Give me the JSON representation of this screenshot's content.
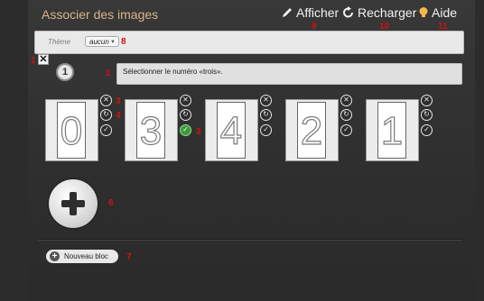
{
  "app": {
    "title": "Associer des images"
  },
  "toolbar": {
    "afficher": "Afficher",
    "recharger": "Recharger",
    "aide": "Aide"
  },
  "theme": {
    "label": "Thème",
    "value": "aucun"
  },
  "question": {
    "number": "1",
    "instruction": "Sélectionner le numéro «trois»."
  },
  "cards": [
    {
      "digit": "0",
      "checked": false
    },
    {
      "digit": "3",
      "checked": true
    },
    {
      "digit": "4",
      "checked": false
    },
    {
      "digit": "2",
      "checked": false
    },
    {
      "digit": "1",
      "checked": false
    }
  ],
  "new_block": "Nouveau bloc",
  "annotations": [
    "1",
    "2",
    "3",
    "3",
    "4",
    "6",
    "7",
    "8",
    "9",
    "10",
    "11"
  ],
  "colors": {
    "title": "#d9b48f",
    "annotation": "#d21212",
    "check_ok": "#3a9b3a"
  }
}
